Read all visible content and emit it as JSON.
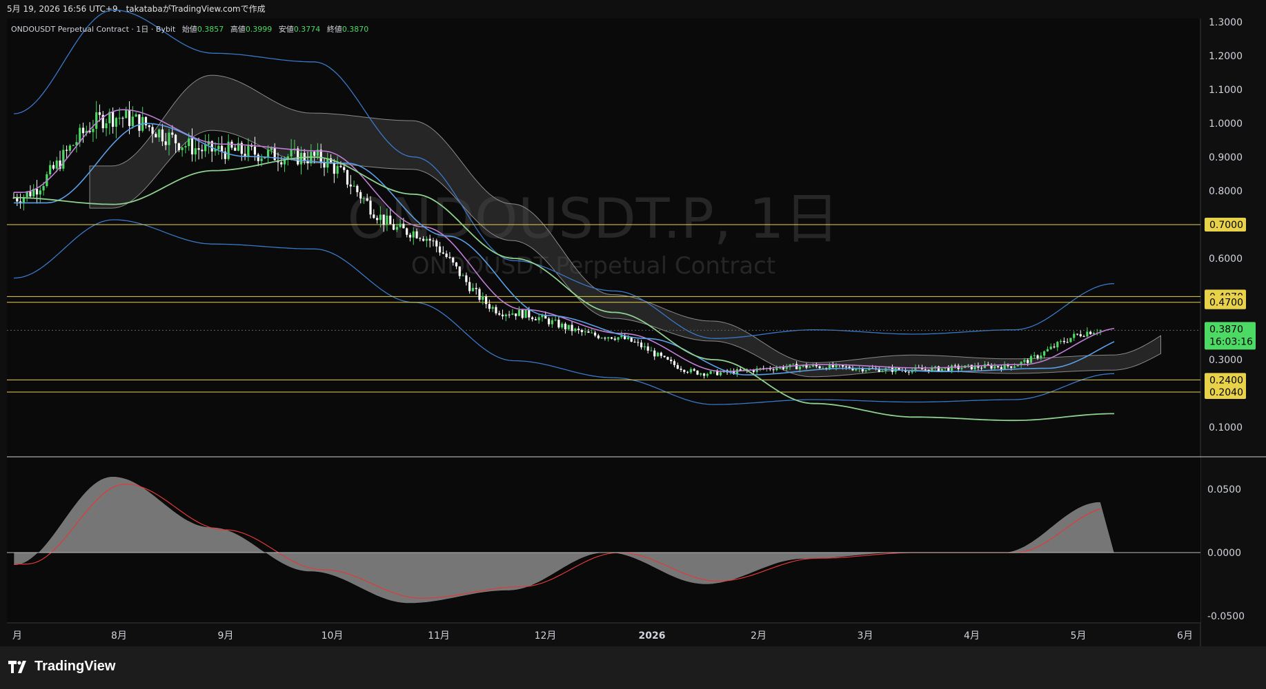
{
  "header": {
    "caption": "5月 19, 2026 16:56 UTC+9、takatabaがTradingView.comで作成"
  },
  "legend": {
    "symbol": "ONDOUSDT Perpetual Contract · 1日 · Bybit",
    "open_label": "始値",
    "open": "0.3857",
    "high_label": "高値",
    "high": "0.3999",
    "low_label": "安値",
    "low": "0.3774",
    "close_label": "終値",
    "close": "0.3870"
  },
  "watermark": {
    "main": "ONDOUSDT.P, 1日",
    "sub": "ONDOUSDT Perpetual Contract"
  },
  "brand": {
    "name": "TradingView",
    "icon": "tradingview-logo-icon"
  },
  "colors": {
    "background": "#0f0f0f",
    "up_candle": "#4cd964",
    "down_candle": "#ffffff",
    "bollinger": "#3a78c9",
    "ema_short": "#c27ed6",
    "ema_mid": "#5aa0e8",
    "ema_long": "#8fd18f",
    "ichimoku_cloud": "#4a4a4a",
    "hline": "#e8d24a",
    "price_badge": "#4cd964",
    "histogram": "#8a8a8a",
    "signal": "#e03a3a"
  },
  "price_axis": {
    "ticks": [
      "1.3000",
      "1.2000",
      "1.1000",
      "1.0000",
      "0.9000",
      "0.8000",
      "0.7000",
      "0.6000",
      "0.4870",
      "0.4700",
      "0.3870",
      "0.3000",
      "0.2400",
      "0.2040",
      "0.1000"
    ],
    "badges": [
      {
        "value": "0.7000"
      },
      {
        "value": "0.4870"
      },
      {
        "value": "0.4700"
      },
      {
        "value": "0.2400"
      },
      {
        "value": "0.2040"
      }
    ],
    "current": {
      "price": "0.3870",
      "countdown": "16:03:16"
    }
  },
  "osc_axis": {
    "ticks": [
      "0.0500",
      "0.0000",
      "-0.0500"
    ]
  },
  "time_axis": {
    "labels": [
      "月",
      "8月",
      "9月",
      "10月",
      "11月",
      "12月",
      "2026",
      "2月",
      "3月",
      "4月",
      "5月",
      "6月"
    ]
  },
  "chart_data": [
    {
      "type": "line",
      "panel": "price",
      "title": "ONDOUSDT.P, 1日",
      "x": [
        "7月",
        "8月",
        "9月",
        "10月",
        "11月",
        "12月",
        "2026",
        "2月",
        "3月",
        "4月",
        "5月",
        "6月"
      ],
      "ylim": [
        0.08,
        1.3
      ],
      "y_scale": "linear",
      "grid": false,
      "series": [
        {
          "kind": "close_approx",
          "values": [
            0.78,
            1.02,
            0.92,
            0.9,
            0.68,
            0.44,
            0.37,
            0.26,
            0.28,
            0.27,
            0.28,
            0.387
          ]
        },
        {
          "kind": "moving_average_long",
          "values": [
            0.78,
            0.76,
            0.86,
            0.9,
            0.79,
            0.6,
            0.44,
            0.3,
            0.17,
            0.13,
            0.12,
            0.14
          ]
        }
      ],
      "horizontal_lines": [
        0.7,
        0.487,
        0.47,
        0.24,
        0.204
      ],
      "last": {
        "open": 0.3857,
        "high": 0.3999,
        "low": 0.3774,
        "close": 0.387
      }
    },
    {
      "type": "area",
      "panel": "oscillator",
      "ylim": [
        -0.055,
        0.065
      ],
      "x": [
        "7月",
        "8月",
        "9月",
        "10月",
        "11月",
        "12月",
        "2026",
        "2月",
        "3月",
        "4月",
        "5月",
        "6月"
      ],
      "series": [
        {
          "kind": "histogram",
          "values": [
            -0.01,
            0.06,
            0.02,
            -0.015,
            -0.04,
            -0.03,
            0.0,
            -0.025,
            -0.005,
            0.0,
            0.0,
            0.04
          ]
        }
      ]
    }
  ]
}
